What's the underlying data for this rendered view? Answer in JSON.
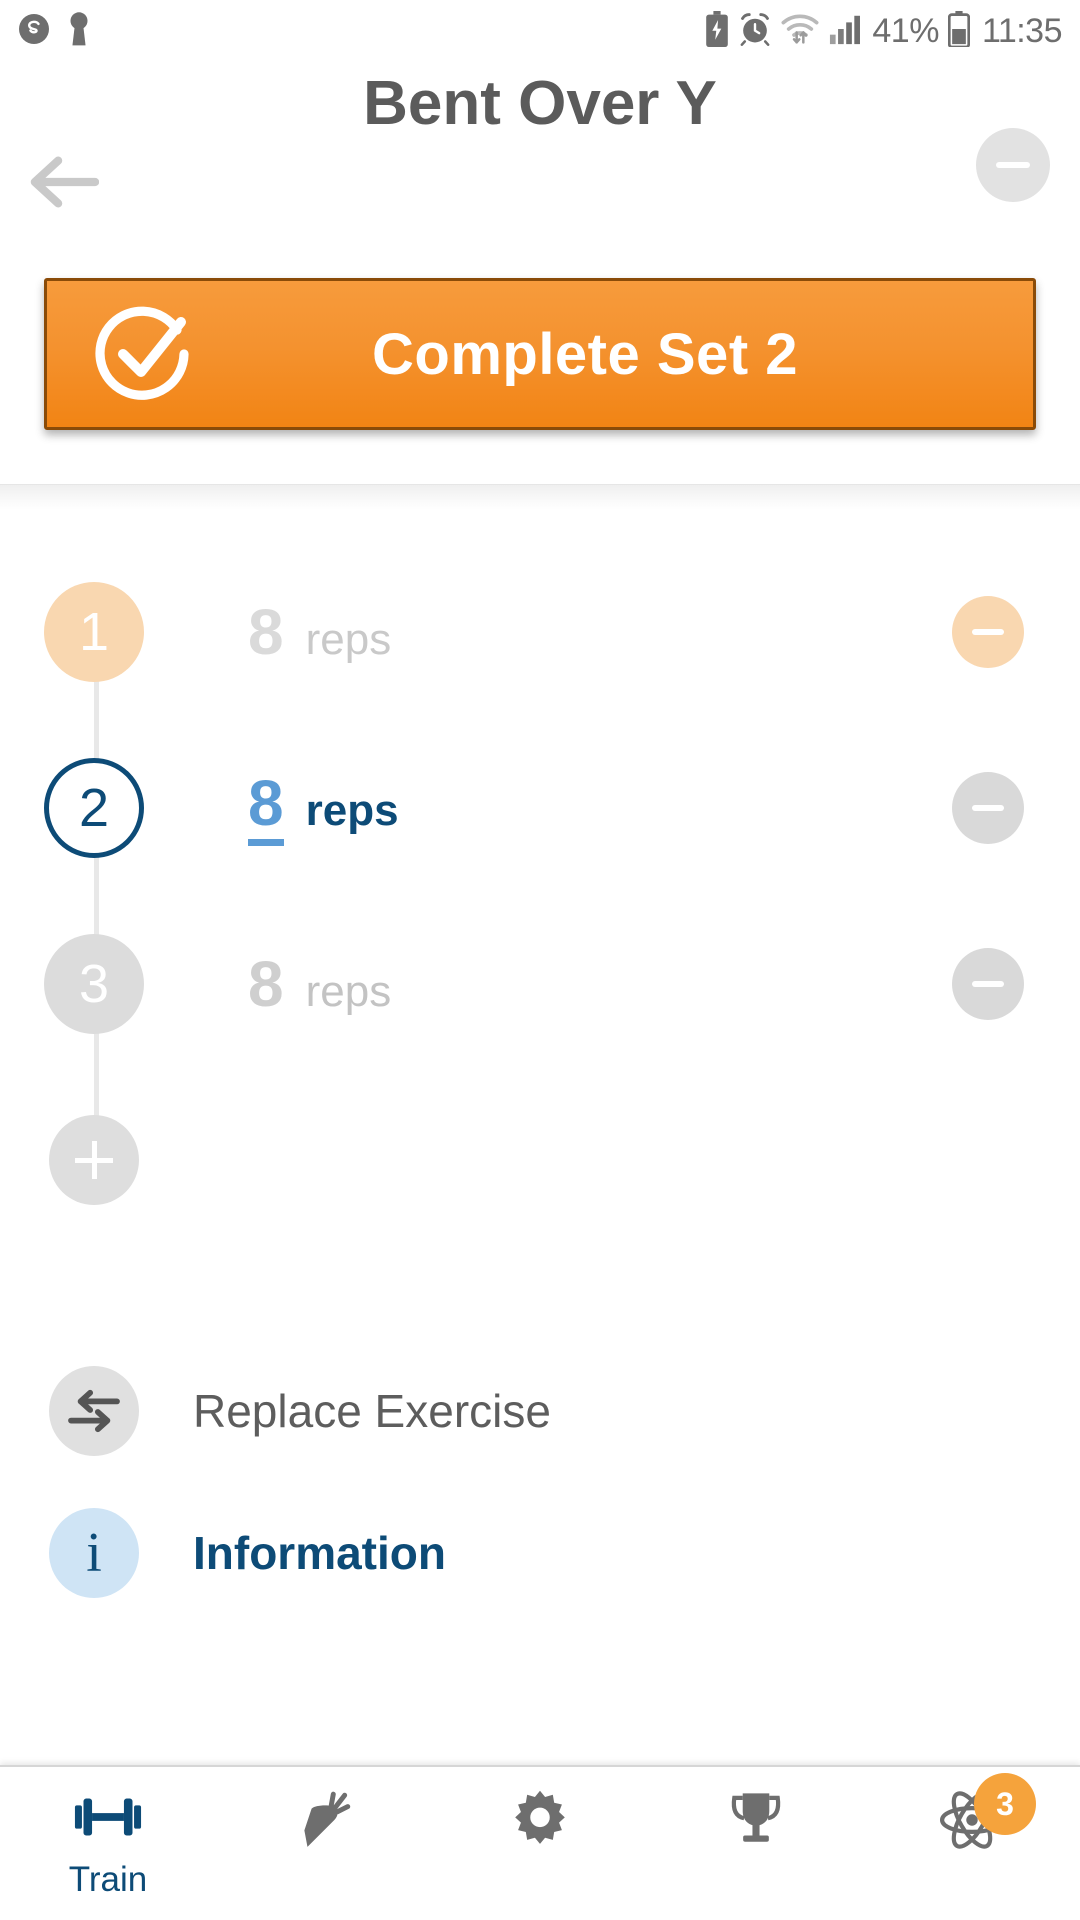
{
  "status_bar": {
    "left_icons": [
      "skype-icon",
      "keyhole-icon"
    ],
    "right_icons": [
      "battery-saver-icon",
      "alarm-icon",
      "wifi-icon",
      "signal-icon"
    ],
    "battery_percent": "41%",
    "battery_icon": "battery-icon",
    "time": "11:35"
  },
  "header": {
    "back_icon": "back-arrow-icon",
    "remove_exercise_icon": "minus-icon",
    "title": "Bent Over Y"
  },
  "cta": {
    "icon": "circle-check-icon",
    "label": "Complete Set 2",
    "bg_color": "#f4922f",
    "border_color": "#8a4b08",
    "text_color": "#ffffff"
  },
  "sets": [
    {
      "number": "1",
      "state": "completed",
      "reps_value": "8",
      "reps_label": "reps",
      "remove_icon": "minus-icon",
      "dot_color": "#f9d7b0",
      "remove_color": "#f9d7b0"
    },
    {
      "number": "2",
      "state": "active",
      "reps_value": "8",
      "reps_label": "reps",
      "remove_icon": "minus-icon",
      "dot_color": "#0d4b77",
      "remove_color": "#d9d9d9"
    },
    {
      "number": "3",
      "state": "pending",
      "reps_value": "8",
      "reps_label": "reps",
      "remove_icon": "minus-icon",
      "dot_color": "#dcdcdc",
      "remove_color": "#d9d9d9"
    }
  ],
  "add_set": {
    "icon": "plus-icon"
  },
  "menu": [
    {
      "icon": "swap-arrows-icon",
      "label": "Replace Exercise",
      "style": "grey"
    },
    {
      "icon": "info-icon",
      "label": "Information",
      "style": "blue"
    }
  ],
  "bottom_nav": {
    "items": [
      {
        "icon": "dumbbell-icon",
        "label": "Train",
        "active": true
      },
      {
        "icon": "carrot-icon",
        "label": "",
        "active": false
      },
      {
        "icon": "gear-icon",
        "label": "",
        "active": false
      },
      {
        "icon": "trophy-icon",
        "label": "",
        "active": false
      },
      {
        "icon": "atom-icon",
        "label": "",
        "active": false,
        "badge": "3"
      }
    ],
    "active_color": "#0d4b77",
    "inactive_color": "#6e6e6e",
    "badge_color": "#f5a33c"
  }
}
